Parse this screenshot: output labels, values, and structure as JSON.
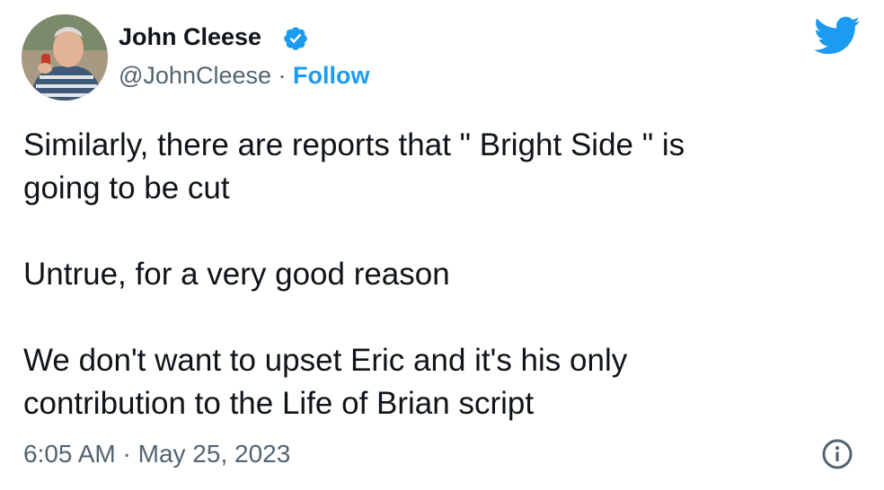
{
  "tweet": {
    "author_name": "John Cleese",
    "handle": "@JohnCleese",
    "separator": " · ",
    "follow_label": "Follow",
    "body": "Similarly, there are reports that \" Bright Side \" is\ngoing to be cut\n\nUntrue, for a very good reason\n\nWe don't want to upset Eric and it's his only\ncontribution to the Life of Brian script",
    "time": "6:05 AM",
    "date_separator": " · ",
    "date": "May 25, 2023"
  },
  "icons": {
    "verified": "verified-badge-icon",
    "brand": "twitter-bird-icon",
    "info": "info-icon"
  },
  "colors": {
    "accent": "#1d9bf0",
    "text": "#0f1419",
    "muted": "#536471"
  }
}
